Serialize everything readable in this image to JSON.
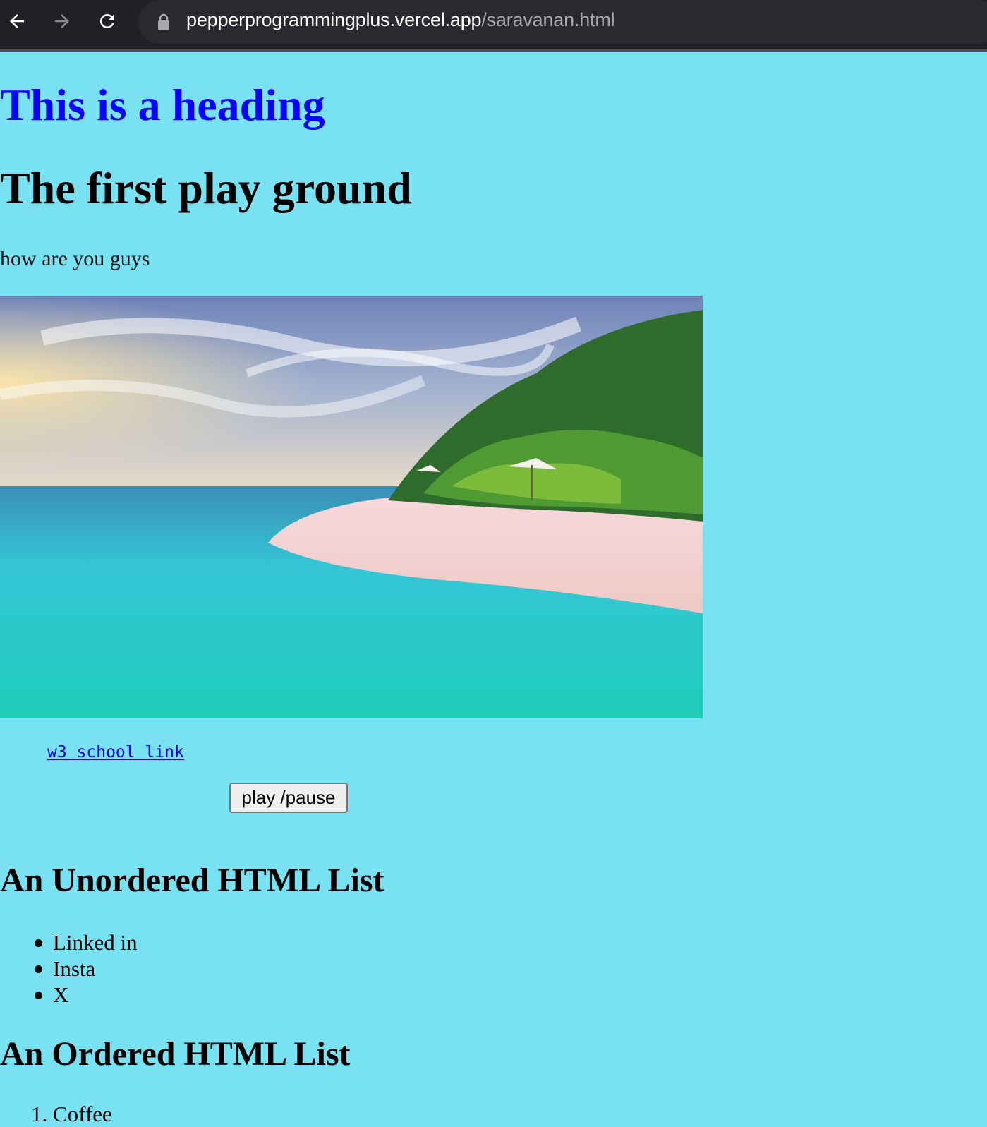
{
  "browser": {
    "url_host": "pepperprogrammingplus.vercel.app",
    "url_path": "/saravanan.html"
  },
  "page": {
    "heading": "This is a heading",
    "subheading": "The first play ground",
    "paragraph": "how are you guys",
    "image_icon": "beach-photo",
    "link_text": "w3 school link",
    "play_button": "play /pause",
    "unordered_heading": "An Unordered HTML List",
    "unordered_items": [
      "Linked in",
      "Insta",
      "X"
    ],
    "ordered_heading": "An Ordered HTML List",
    "ordered_items": [
      "Coffee"
    ]
  },
  "colors": {
    "page_background": "#79e2f2",
    "heading": "#0a00ff",
    "link": "#0000ee",
    "toolbar": "#202124"
  }
}
